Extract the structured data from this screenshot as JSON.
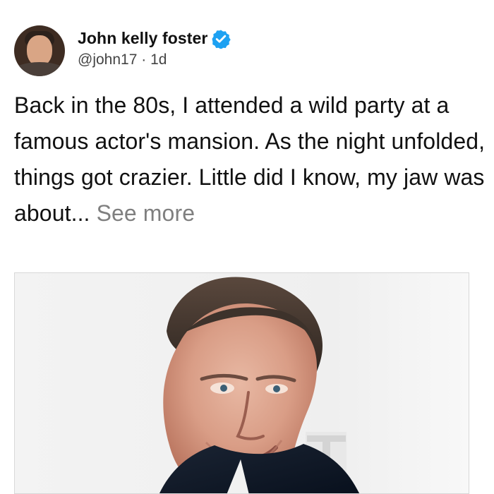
{
  "post": {
    "author_name": "John kelly foster",
    "author_handle": "@john17",
    "separator": "·",
    "time_ago": "1d",
    "body_text": "Back in the 80s, I attended a wild party at a famous actor's mansion. As the night unfolded, things got crazier. Little did I know, my jaw was about...",
    "see_more_label": "See more",
    "verified_color": "#1DA1F2"
  },
  "icons": {
    "avatar": "avatar-image",
    "verified": "verified-badge-icon",
    "photo": "portrait-photo"
  }
}
